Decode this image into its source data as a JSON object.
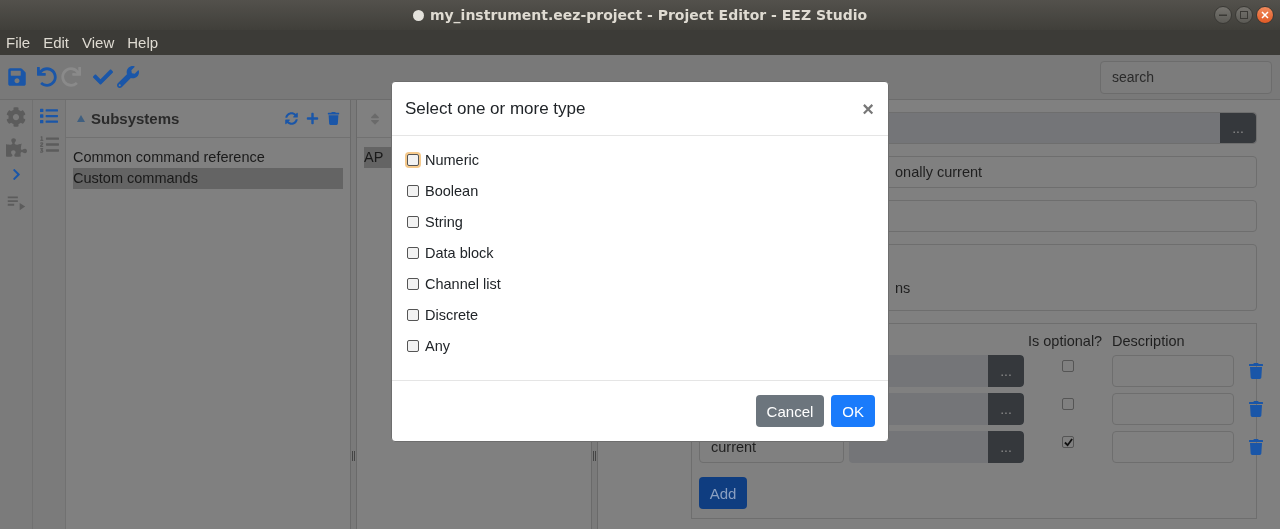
{
  "window": {
    "title": "my_instrument.eez-project - Project Editor - EEZ Studio",
    "modified": true
  },
  "menu": [
    "File",
    "Edit",
    "View",
    "Help"
  ],
  "toolbar": {
    "buttons": [
      {
        "kind": "save",
        "disabled": false
      },
      {
        "kind": "undo",
        "disabled": false
      },
      {
        "kind": "redo",
        "disabled": true
      },
      {
        "kind": "check",
        "disabled": false
      },
      {
        "kind": "wrench",
        "disabled": false
      }
    ],
    "search": {
      "placeholder": "search"
    }
  },
  "subsystems": {
    "title": "Subsystems",
    "items": [
      {
        "label": "Common command reference",
        "selected": false
      },
      {
        "label": "Custom commands",
        "selected": true
      }
    ]
  },
  "commands": {
    "items": [
      {
        "label": "AP",
        "selected": true
      }
    ]
  },
  "editor": {
    "fields": [
      {
        "kind": "picker",
        "button": "..."
      },
      {
        "kind": "text",
        "value": "onally current"
      },
      {
        "kind": "text"
      },
      {
        "kind": "textarea",
        "value": "ns"
      }
    ],
    "parameters": {
      "columns": [
        "Is optional?",
        "Description"
      ],
      "rows": [
        {
          "button": "...",
          "optional": false
        },
        {
          "button": "...",
          "optional": false
        },
        {
          "name": "current",
          "button": "...",
          "optional": true
        }
      ],
      "add_button": "Add"
    }
  },
  "dialog": {
    "title": "Select one or more type",
    "close": "×",
    "options": [
      {
        "label": "Numeric",
        "checked": false,
        "focused": true
      },
      {
        "label": "Boolean",
        "checked": false,
        "focused": false
      },
      {
        "label": "String",
        "checked": false,
        "focused": false
      },
      {
        "label": "Data block",
        "checked": false,
        "focused": false
      },
      {
        "label": "Channel list",
        "checked": false,
        "focused": false
      },
      {
        "label": "Discrete",
        "checked": false,
        "focused": false
      },
      {
        "label": "Any",
        "checked": false,
        "focused": false
      }
    ],
    "buttons": [
      {
        "label": "Cancel",
        "kind": "secondary"
      },
      {
        "label": "OK",
        "kind": "primary"
      }
    ]
  }
}
